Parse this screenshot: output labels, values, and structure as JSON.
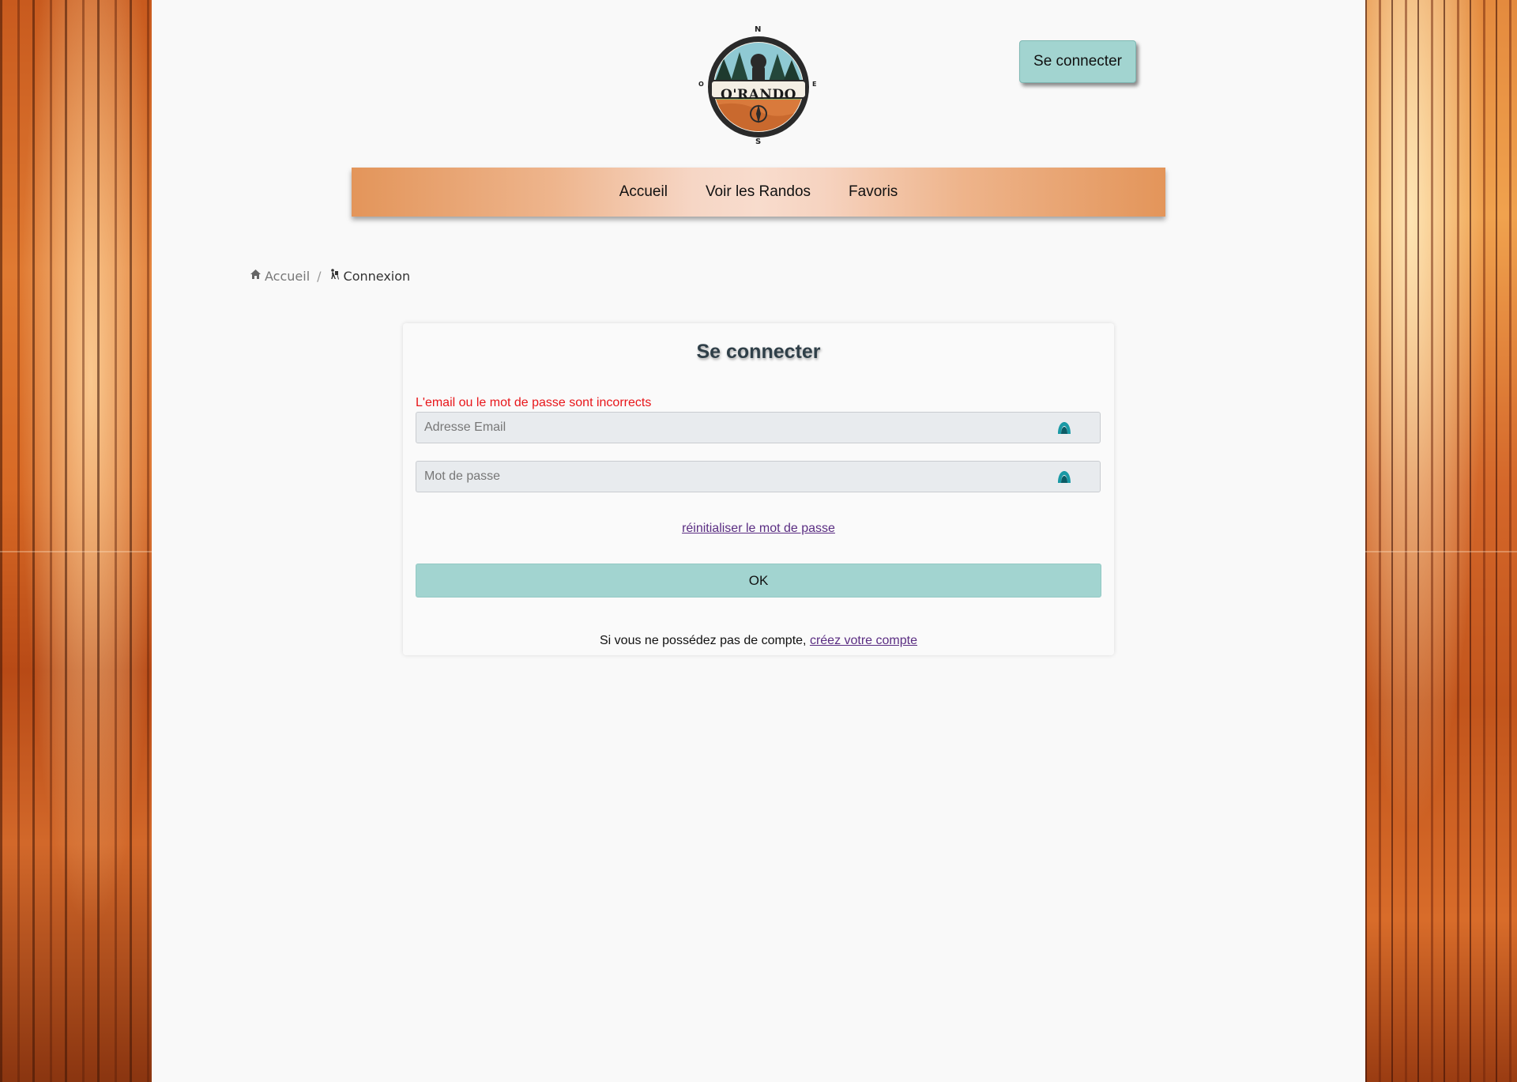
{
  "logo": {
    "brand": "O'RANDO",
    "compass": {
      "n": "N",
      "s": "S",
      "o": "O",
      "e": "E"
    }
  },
  "header": {
    "login_button": "Se connecter"
  },
  "nav": {
    "items": [
      {
        "label": "Accueil"
      },
      {
        "label": "Voir les Randos"
      },
      {
        "label": "Favoris"
      }
    ]
  },
  "breadcrumb": {
    "home": "Accueil",
    "separator": "/",
    "current": "Connexion",
    "home_icon": "home-icon",
    "current_icon": "hiker-icon"
  },
  "login_form": {
    "title": "Se connecter",
    "error": "L'email ou le mot de passe sont incorrects",
    "email_placeholder": "Adresse Email",
    "email_value": "",
    "password_placeholder": "Mot de passe",
    "password_value": "",
    "reset_link": "réinitialiser le mot de passe",
    "submit": "OK",
    "signup_text": "Si vous ne possédez pas de compte, ",
    "signup_link": "créez votre compte"
  },
  "colors": {
    "accent": "#a2d4d0",
    "error": "#e8161a",
    "link": "#5a2d82",
    "nav_edge": "#e3955a",
    "nav_center": "#f8dccd"
  }
}
